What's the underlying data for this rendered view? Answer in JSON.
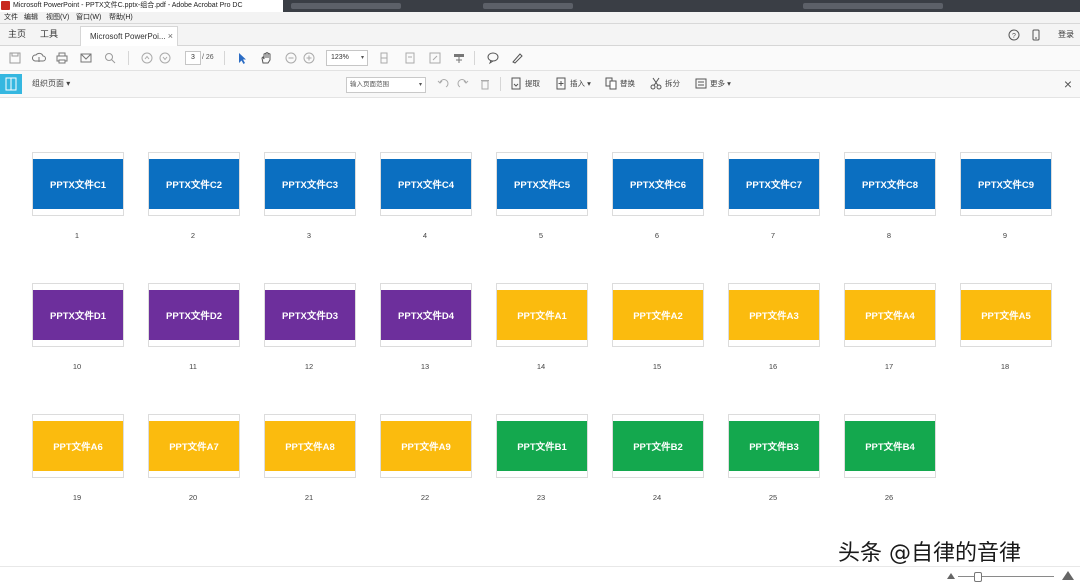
{
  "window": {
    "title": "Microsoft PowerPoint - PPTX文件C.pptx-组合.pdf - Adobe Acrobat Pro DC"
  },
  "menu": [
    "文件",
    "编辑",
    "视图(V)",
    "窗口(W)",
    "帮助(H)"
  ],
  "tabs": {
    "home": "主页",
    "tools": "工具",
    "document": "Microsoft PowerPoi...",
    "close": "×",
    "login": "登录"
  },
  "toolbar": {
    "current_page": "3",
    "page_total": "/ 26",
    "zoom": "123%",
    "zoom_caret": "▾"
  },
  "organize": {
    "title": "组织页面 ▾",
    "range": "输入页面范围",
    "range_caret": "▾",
    "extract": "提取",
    "insert": "插入 ▾",
    "replace": "替换",
    "split": "拆分",
    "more": "更多 ▾",
    "close": "×"
  },
  "pages": [
    {
      "label": "PPTX文件C1",
      "num": "1",
      "color": "#0b6fc1"
    },
    {
      "label": "PPTX文件C2",
      "num": "2",
      "color": "#0b6fc1"
    },
    {
      "label": "PPTX文件C3",
      "num": "3",
      "color": "#0b6fc1"
    },
    {
      "label": "PPTX文件C4",
      "num": "4",
      "color": "#0b6fc1"
    },
    {
      "label": "PPTX文件C5",
      "num": "5",
      "color": "#0b6fc1"
    },
    {
      "label": "PPTX文件C6",
      "num": "6",
      "color": "#0b6fc1"
    },
    {
      "label": "PPTX文件C7",
      "num": "7",
      "color": "#0b6fc1"
    },
    {
      "label": "PPTX文件C8",
      "num": "8",
      "color": "#0b6fc1"
    },
    {
      "label": "PPTX文件C9",
      "num": "9",
      "color": "#0b6fc1"
    },
    {
      "label": "PPTX文件D1",
      "num": "10",
      "color": "#6d2f9c"
    },
    {
      "label": "PPTX文件D2",
      "num": "11",
      "color": "#6d2f9c"
    },
    {
      "label": "PPTX文件D3",
      "num": "12",
      "color": "#6d2f9c"
    },
    {
      "label": "PPTX文件D4",
      "num": "13",
      "color": "#6d2f9c"
    },
    {
      "label": "PPT文件A1",
      "num": "14",
      "color": "#fbbb0e"
    },
    {
      "label": "PPT文件A2",
      "num": "15",
      "color": "#fbbb0e"
    },
    {
      "label": "PPT文件A3",
      "num": "16",
      "color": "#fbbb0e"
    },
    {
      "label": "PPT文件A4",
      "num": "17",
      "color": "#fbbb0e"
    },
    {
      "label": "PPT文件A5",
      "num": "18",
      "color": "#fbbb0e"
    },
    {
      "label": "PPT文件A6",
      "num": "19",
      "color": "#fbbb0e"
    },
    {
      "label": "PPT文件A7",
      "num": "20",
      "color": "#fbbb0e"
    },
    {
      "label": "PPT文件A8",
      "num": "21",
      "color": "#fbbb0e"
    },
    {
      "label": "PPT文件A9",
      "num": "22",
      "color": "#fbbb0e"
    },
    {
      "label": "PPT文件B1",
      "num": "23",
      "color": "#14a84e"
    },
    {
      "label": "PPT文件B2",
      "num": "24",
      "color": "#14a84e"
    },
    {
      "label": "PPT文件B3",
      "num": "25",
      "color": "#14a84e"
    },
    {
      "label": "PPT文件B4",
      "num": "26",
      "color": "#14a84e"
    }
  ],
  "watermark": "头条 @自律的音律"
}
